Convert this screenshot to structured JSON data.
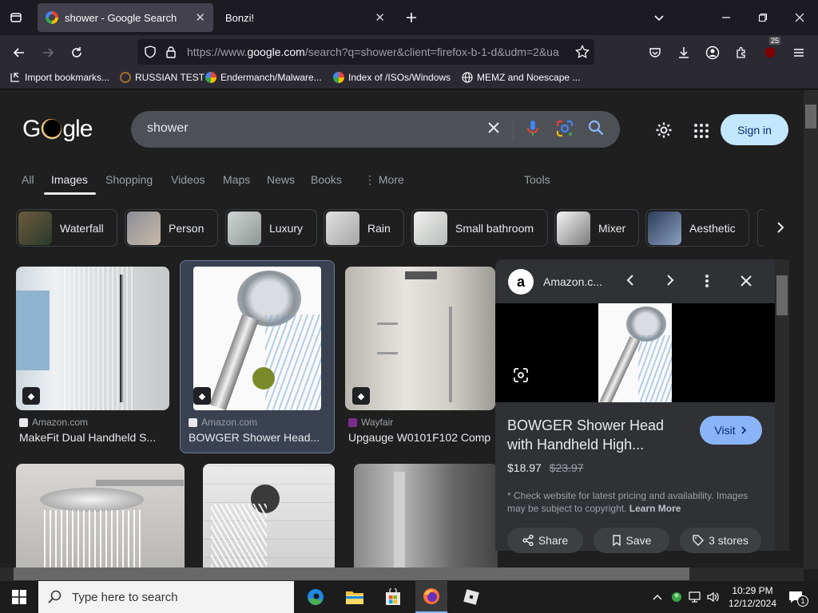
{
  "browser": {
    "tabs": [
      {
        "title": "shower - Google Search",
        "active": true
      },
      {
        "title": "Bonzi!",
        "active": false
      }
    ],
    "url_prefix": "https://www.",
    "url_domain": "google.com",
    "url_rest": "/search?q=shower&client=firefox-b-1-d&udm=2&ua",
    "notification_count": "25",
    "bookmarks": [
      "Import bookmarks...",
      "RUSSIAN TEST",
      "Endermanch/Malware...",
      "Index of /ISOs/Windows",
      "MEMZ and Noescape ..."
    ]
  },
  "google": {
    "logo_left": "G",
    "logo_right": "gle",
    "query": "shower",
    "signin_label": "Sign in",
    "nav_tabs": [
      "All",
      "Images",
      "Shopping",
      "Videos",
      "Maps",
      "News",
      "Books",
      "More"
    ],
    "more_glyph": "⋮",
    "tools_label": "Tools",
    "chips": [
      "Waterfall",
      "Person",
      "Luxury",
      "Rain",
      "Small bathroom",
      "Mixer",
      "Aesthetic"
    ]
  },
  "results": [
    {
      "source": "Amazon.com",
      "title": "MakeFit Dual Handheld S..."
    },
    {
      "source": "Amazon.com",
      "title": "BOWGER Shower Head..."
    },
    {
      "source": "Wayfair",
      "title": "Upgauge W0101F102 Comp"
    }
  ],
  "panel": {
    "source": "Amazon.c...",
    "title_line1": "BOWGER Shower Head",
    "title_line2": "with Handheld High...",
    "visit_label": "Visit",
    "price": "$18.97",
    "old_price": "$23.97",
    "disclaimer": "* Check website for latest pricing and availability. Images may be subject to copyright.",
    "learn_more": "Learn More",
    "share_label": "Share",
    "save_label": "Save",
    "stores_label": "3 stores"
  },
  "taskbar": {
    "search_placeholder": "Type here to search",
    "time": "10:29 PM",
    "date": "12/12/2024",
    "notif_count": "1"
  },
  "colors": {
    "page_bg": "#1f1f1f",
    "signin_bg": "#c2e7ff",
    "visit_bg": "#8ab4f8"
  }
}
